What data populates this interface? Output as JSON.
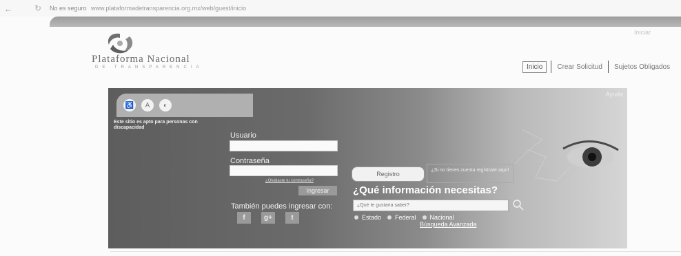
{
  "browser": {
    "back_icon": "back-arrow-icon",
    "reload_icon": "reload-icon",
    "security": "No es seguro",
    "url": "www.plataformadetransparencia.org.mx/web/guest/inicio"
  },
  "header": {
    "login_link": "Iniciar",
    "brand_title": "Plataforma Nacional",
    "brand_subtitle": "DE TRANSPARENCIA"
  },
  "nav": {
    "items": [
      {
        "label": "Inicio",
        "active": true
      },
      {
        "label": "Crear Solicitud",
        "active": false
      },
      {
        "label": "Sujetos Obligados",
        "active": false
      }
    ]
  },
  "hero": {
    "help": "Ayuda",
    "accessibility_icons": [
      "accessibility-icon",
      "font-size-icon",
      "contrast-icon"
    ],
    "accessibility_text": "Este sitio es apto para personas con discapacidad",
    "username_label": "Usuario",
    "username_value": "",
    "password_label": "Contraseña",
    "password_value": "",
    "forgot_password": "¿Olvidaste tu contraseña?",
    "login_button": "Ingresar",
    "social_label": "También puedes ingresar con:",
    "social_icons": [
      {
        "name": "facebook-icon",
        "glyph": "f"
      },
      {
        "name": "google-plus-icon",
        "glyph": "g+"
      },
      {
        "name": "twitter-icon",
        "glyph": "t"
      }
    ],
    "register_button": "Registro",
    "no_account_text": "¿Si no tienes cuenta regístrate aquí!",
    "question": "¿Qué información necesitas?",
    "search_placeholder": "¿Qué te gustaría saber?",
    "scope_options": [
      "Estado",
      "Federal",
      "Nacional"
    ],
    "advanced_search": "Búsqueda Avanzada"
  }
}
